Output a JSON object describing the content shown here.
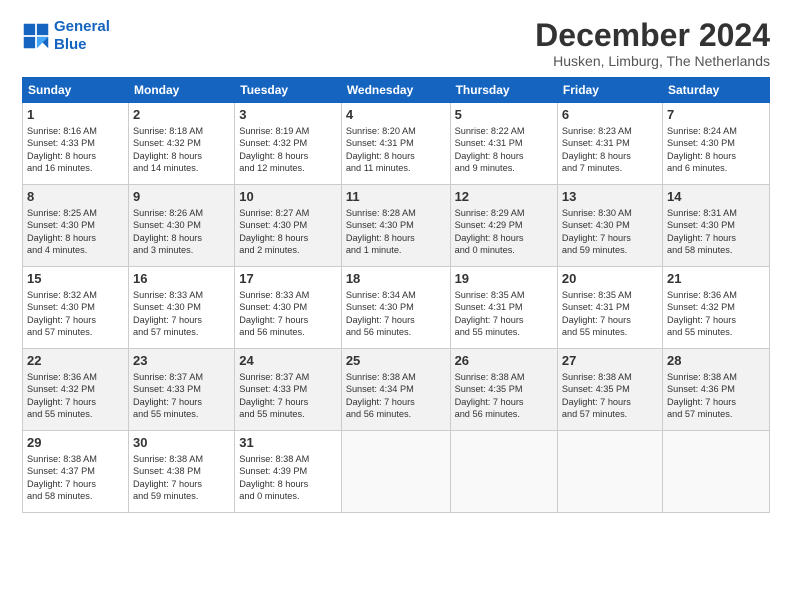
{
  "logo": {
    "line1": "General",
    "line2": "Blue"
  },
  "title": "December 2024",
  "location": "Husken, Limburg, The Netherlands",
  "headers": [
    "Sunday",
    "Monday",
    "Tuesday",
    "Wednesday",
    "Thursday",
    "Friday",
    "Saturday"
  ],
  "weeks": [
    [
      {
        "day": "1",
        "info": "Sunrise: 8:16 AM\nSunset: 4:33 PM\nDaylight: 8 hours\nand 16 minutes."
      },
      {
        "day": "2",
        "info": "Sunrise: 8:18 AM\nSunset: 4:32 PM\nDaylight: 8 hours\nand 14 minutes."
      },
      {
        "day": "3",
        "info": "Sunrise: 8:19 AM\nSunset: 4:32 PM\nDaylight: 8 hours\nand 12 minutes."
      },
      {
        "day": "4",
        "info": "Sunrise: 8:20 AM\nSunset: 4:31 PM\nDaylight: 8 hours\nand 11 minutes."
      },
      {
        "day": "5",
        "info": "Sunrise: 8:22 AM\nSunset: 4:31 PM\nDaylight: 8 hours\nand 9 minutes."
      },
      {
        "day": "6",
        "info": "Sunrise: 8:23 AM\nSunset: 4:31 PM\nDaylight: 8 hours\nand 7 minutes."
      },
      {
        "day": "7",
        "info": "Sunrise: 8:24 AM\nSunset: 4:30 PM\nDaylight: 8 hours\nand 6 minutes."
      }
    ],
    [
      {
        "day": "8",
        "info": "Sunrise: 8:25 AM\nSunset: 4:30 PM\nDaylight: 8 hours\nand 4 minutes."
      },
      {
        "day": "9",
        "info": "Sunrise: 8:26 AM\nSunset: 4:30 PM\nDaylight: 8 hours\nand 3 minutes."
      },
      {
        "day": "10",
        "info": "Sunrise: 8:27 AM\nSunset: 4:30 PM\nDaylight: 8 hours\nand 2 minutes."
      },
      {
        "day": "11",
        "info": "Sunrise: 8:28 AM\nSunset: 4:30 PM\nDaylight: 8 hours\nand 1 minute."
      },
      {
        "day": "12",
        "info": "Sunrise: 8:29 AM\nSunset: 4:29 PM\nDaylight: 8 hours\nand 0 minutes."
      },
      {
        "day": "13",
        "info": "Sunrise: 8:30 AM\nSunset: 4:30 PM\nDaylight: 7 hours\nand 59 minutes."
      },
      {
        "day": "14",
        "info": "Sunrise: 8:31 AM\nSunset: 4:30 PM\nDaylight: 7 hours\nand 58 minutes."
      }
    ],
    [
      {
        "day": "15",
        "info": "Sunrise: 8:32 AM\nSunset: 4:30 PM\nDaylight: 7 hours\nand 57 minutes."
      },
      {
        "day": "16",
        "info": "Sunrise: 8:33 AM\nSunset: 4:30 PM\nDaylight: 7 hours\nand 57 minutes."
      },
      {
        "day": "17",
        "info": "Sunrise: 8:33 AM\nSunset: 4:30 PM\nDaylight: 7 hours\nand 56 minutes."
      },
      {
        "day": "18",
        "info": "Sunrise: 8:34 AM\nSunset: 4:30 PM\nDaylight: 7 hours\nand 56 minutes."
      },
      {
        "day": "19",
        "info": "Sunrise: 8:35 AM\nSunset: 4:31 PM\nDaylight: 7 hours\nand 55 minutes."
      },
      {
        "day": "20",
        "info": "Sunrise: 8:35 AM\nSunset: 4:31 PM\nDaylight: 7 hours\nand 55 minutes."
      },
      {
        "day": "21",
        "info": "Sunrise: 8:36 AM\nSunset: 4:32 PM\nDaylight: 7 hours\nand 55 minutes."
      }
    ],
    [
      {
        "day": "22",
        "info": "Sunrise: 8:36 AM\nSunset: 4:32 PM\nDaylight: 7 hours\nand 55 minutes."
      },
      {
        "day": "23",
        "info": "Sunrise: 8:37 AM\nSunset: 4:33 PM\nDaylight: 7 hours\nand 55 minutes."
      },
      {
        "day": "24",
        "info": "Sunrise: 8:37 AM\nSunset: 4:33 PM\nDaylight: 7 hours\nand 55 minutes."
      },
      {
        "day": "25",
        "info": "Sunrise: 8:38 AM\nSunset: 4:34 PM\nDaylight: 7 hours\nand 56 minutes."
      },
      {
        "day": "26",
        "info": "Sunrise: 8:38 AM\nSunset: 4:35 PM\nDaylight: 7 hours\nand 56 minutes."
      },
      {
        "day": "27",
        "info": "Sunrise: 8:38 AM\nSunset: 4:35 PM\nDaylight: 7 hours\nand 57 minutes."
      },
      {
        "day": "28",
        "info": "Sunrise: 8:38 AM\nSunset: 4:36 PM\nDaylight: 7 hours\nand 57 minutes."
      }
    ],
    [
      {
        "day": "29",
        "info": "Sunrise: 8:38 AM\nSunset: 4:37 PM\nDaylight: 7 hours\nand 58 minutes."
      },
      {
        "day": "30",
        "info": "Sunrise: 8:38 AM\nSunset: 4:38 PM\nDaylight: 7 hours\nand 59 minutes."
      },
      {
        "day": "31",
        "info": "Sunrise: 8:38 AM\nSunset: 4:39 PM\nDaylight: 8 hours\nand 0 minutes."
      },
      null,
      null,
      null,
      null
    ]
  ]
}
